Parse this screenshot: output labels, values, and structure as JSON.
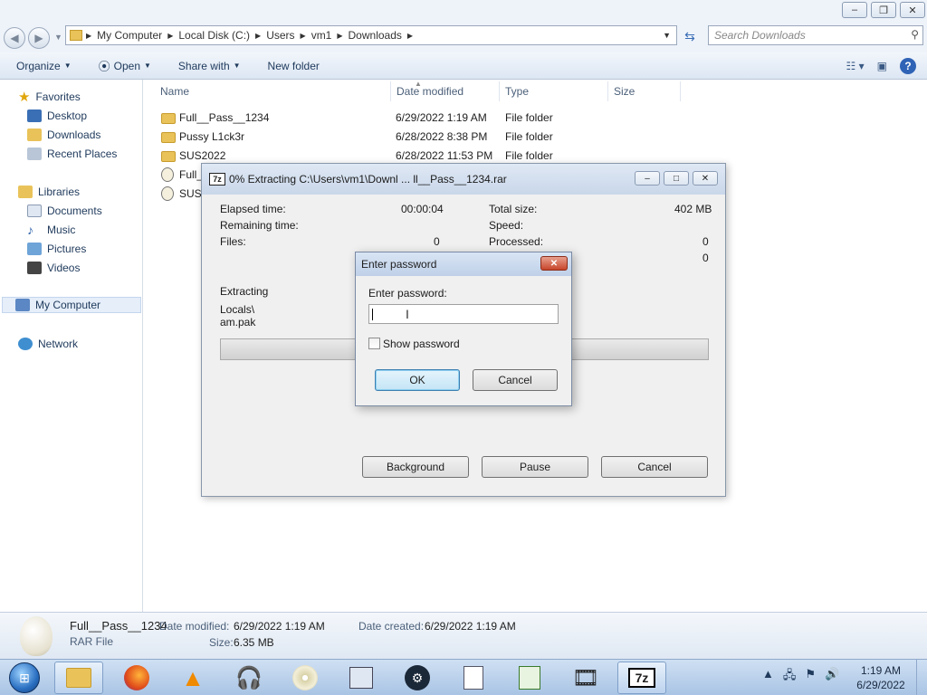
{
  "explorer": {
    "title_buttons": [
      "–",
      "❐",
      "✕"
    ],
    "breadcrumb": [
      "My Computer",
      "Local Disk (C:)",
      "Users",
      "vm1",
      "Downloads"
    ],
    "search_placeholder": "Search Downloads",
    "toolbar": {
      "organize": "Organize",
      "open": "Open",
      "share_with": "Share with",
      "new_folder": "New folder"
    },
    "nav": {
      "favorites": "Favorites",
      "desktop": "Desktop",
      "downloads": "Downloads",
      "recent_places": "Recent Places",
      "libraries": "Libraries",
      "documents": "Documents",
      "music": "Music",
      "pictures": "Pictures",
      "videos": "Videos",
      "my_computer": "My Computer",
      "network": "Network"
    },
    "columns": [
      "Name",
      "Date modified",
      "Type",
      "Size"
    ],
    "files": [
      {
        "name": "Full__Pass__1234",
        "date": "6/29/2022 1:19 AM",
        "type": "File folder",
        "kind": "folder"
      },
      {
        "name": "Pussy L1ck3r",
        "date": "6/28/2022 8:38 PM",
        "type": "File folder",
        "kind": "folder"
      },
      {
        "name": "SUS2022",
        "date": "6/28/2022 11:53 PM",
        "type": "File folder",
        "kind": "folder"
      },
      {
        "name": "Full_",
        "date": "",
        "type": "",
        "kind": "rar"
      },
      {
        "name": "SUS2",
        "date": "",
        "type": "",
        "kind": "rar"
      }
    ],
    "details": {
      "name": "Full__Pass__1234",
      "type": "RAR File",
      "date_modified_label": "Date modified:",
      "date_modified": "6/29/2022 1:19 AM",
      "date_created_label": "Date created:",
      "date_created": "6/29/2022 1:19 AM",
      "size_label": "Size:",
      "size": "6.35 MB"
    }
  },
  "extract_dialog": {
    "app_icon": "7z",
    "title": "0% Extracting C:\\Users\\vm1\\Downl ... ll__Pass__1234.rar",
    "elapsed_label": "Elapsed time:",
    "elapsed": "00:00:04",
    "remaining_label": "Remaining time:",
    "files_label": "Files:",
    "files": "0",
    "total_size_label": "Total size:",
    "total_size": "402 MB",
    "speed_label": "Speed:",
    "processed_label": "Processed:",
    "processed": "0",
    "extra_value": "0",
    "extracting_label": "Extracting",
    "path_line1": "Locals\\",
    "path_line2": "am.pak",
    "progress": 0,
    "buttons": {
      "background": "Background",
      "pause": "Pause",
      "cancel": "Cancel"
    }
  },
  "password_dialog": {
    "title": "Enter password",
    "label": "Enter password:",
    "value": "",
    "show_password": "Show password",
    "ok": "OK",
    "cancel": "Cancel"
  },
  "taskbar": {
    "clock_time": "1:19 AM",
    "clock_date": "6/29/2022"
  },
  "colors": {
    "accent": "#3c7fb1",
    "window_bg": "#eef3fa",
    "close_red": "#c7452b"
  }
}
